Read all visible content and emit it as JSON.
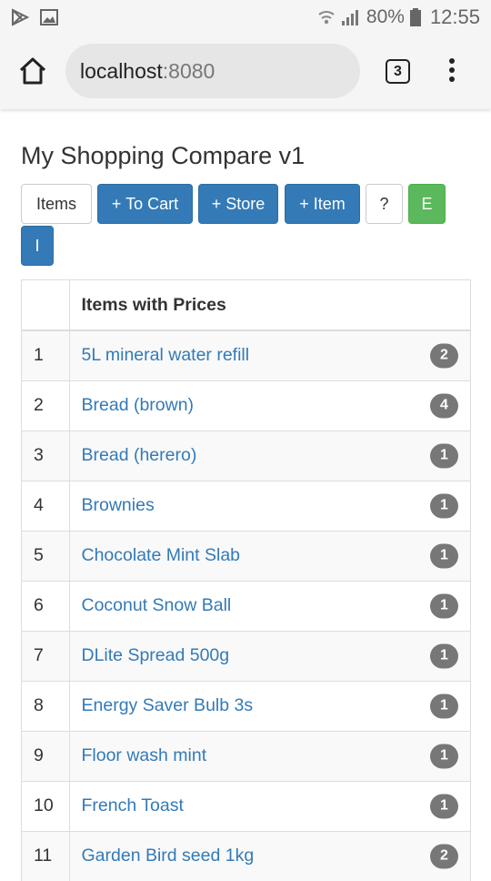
{
  "status": {
    "battery": "80%",
    "time": "12:55"
  },
  "browser": {
    "url_host": "localhost",
    "url_port": ":8080",
    "tab_count": "3"
  },
  "page": {
    "title": "My Shopping Compare v1"
  },
  "toolbar": {
    "items_label": "Items",
    "to_cart_label": "+ To Cart",
    "store_label": "+ Store",
    "item_label": "+ Item",
    "help_label": "?",
    "e_label": "E",
    "i_label": "I"
  },
  "table": {
    "header_num": "",
    "header_items": "Items with Prices",
    "rows": [
      {
        "num": "1",
        "name": "5L mineral water refill",
        "count": "2"
      },
      {
        "num": "2",
        "name": "Bread (brown)",
        "count": "4"
      },
      {
        "num": "3",
        "name": "Bread (herero)",
        "count": "1"
      },
      {
        "num": "4",
        "name": "Brownies",
        "count": "1"
      },
      {
        "num": "5",
        "name": "Chocolate Mint Slab",
        "count": "1"
      },
      {
        "num": "6",
        "name": "Coconut Snow Ball",
        "count": "1"
      },
      {
        "num": "7",
        "name": "DLite Spread 500g",
        "count": "1"
      },
      {
        "num": "8",
        "name": "Energy Saver Bulb 3s",
        "count": "1"
      },
      {
        "num": "9",
        "name": "Floor wash mint",
        "count": "1"
      },
      {
        "num": "10",
        "name": "French Toast",
        "count": "1"
      },
      {
        "num": "11",
        "name": "Garden Bird seed 1kg",
        "count": "2"
      }
    ]
  },
  "colors": {
    "primary": "#337ab7",
    "success": "#5cb85c",
    "badge": "#777777",
    "link": "#337ab7"
  }
}
